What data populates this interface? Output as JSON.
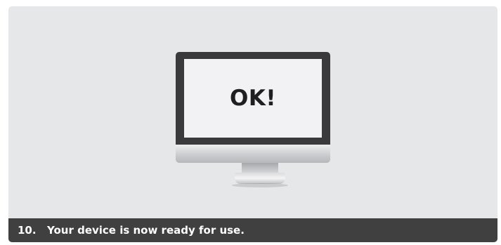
{
  "illustration": {
    "icon": "monitor-icon",
    "screen_text": "OK!"
  },
  "caption": {
    "step_number": "10.",
    "text": "Your device is now ready for use."
  },
  "colors": {
    "panel_background": "#e6e7e9",
    "caption_background": "#404041",
    "caption_text": "#ffffff",
    "monitor_bezel": "#3a3a3c",
    "screen_background": "#f2f2f4",
    "screen_text": "#1f1f21"
  }
}
